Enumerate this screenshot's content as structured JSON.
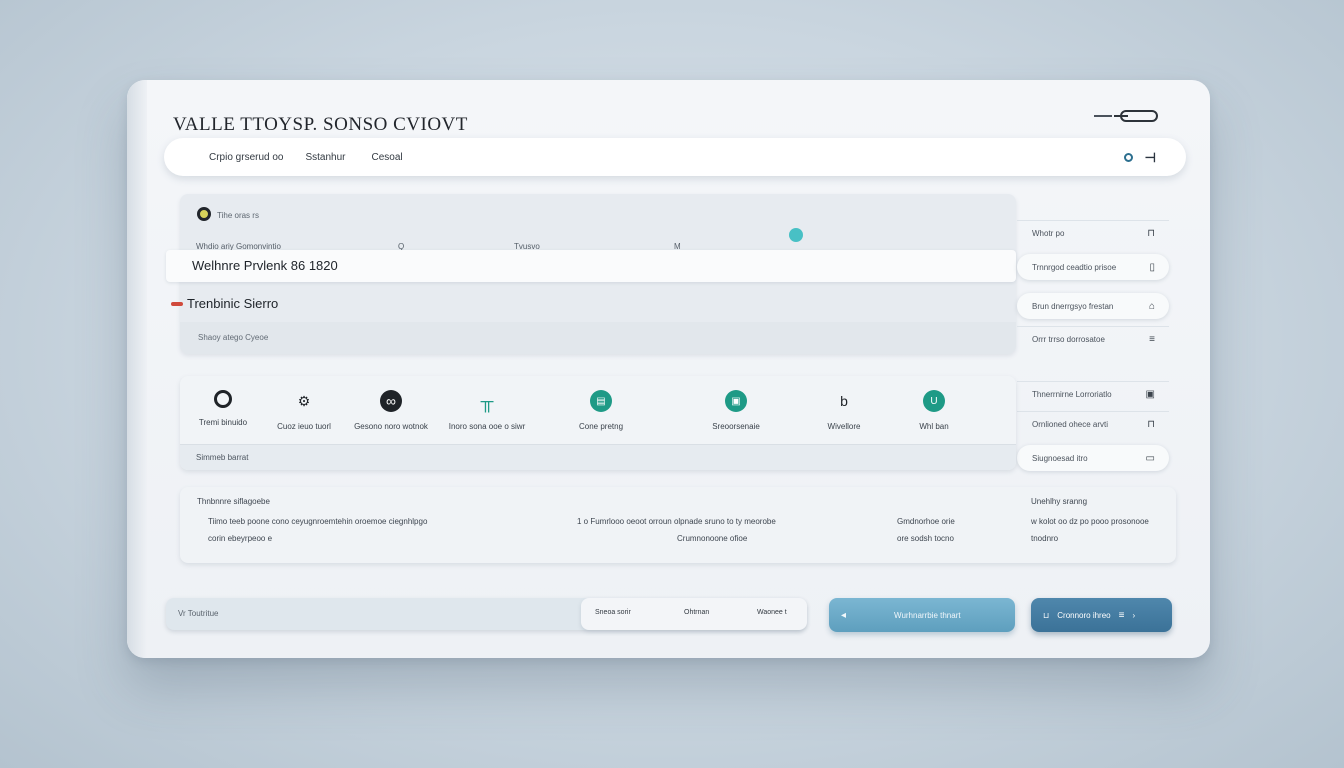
{
  "app": {
    "title": "VALLE TTOYSP. SONSO CVIOVT"
  },
  "top_bar": {
    "tabs": [
      "Crpio grserud oo",
      "Sstanhur",
      "Cesoal"
    ]
  },
  "panel_a": {
    "subtitle": "Tihe oras rs",
    "columns": [
      "Whdio ariy Gomonvintio",
      "Q",
      "Tvusvo",
      "M"
    ],
    "record_title": "Welhnre Prvlenk 86 1820",
    "section_name": "Trenbinic Sierro",
    "sub_caption": "Shaoy atego Cyeoe"
  },
  "right_list": [
    {
      "label": "Whotr po",
      "icon": "⊓"
    },
    {
      "label": "Trnnrgod ceadtio prisoe",
      "icon": "▯"
    },
    {
      "label": "Brun dnerrgsyo frestan",
      "icon": "⌂"
    },
    {
      "label": "Orrr trrso dorrosatoe",
      "icon": "≡"
    },
    {
      "label": "Thnerrnirne Lorroriatlo",
      "icon": "▣"
    },
    {
      "label": "Ornlioned ohece arvti",
      "icon": "⊓"
    },
    {
      "label": "Siugnoesad itro",
      "icon": "▭"
    }
  ],
  "tools": [
    {
      "label": "Tremi binuido",
      "icon": "gear-icon",
      "glyph": "⚙"
    },
    {
      "label": "Cuoz ieuo tuorl",
      "icon": "settings-icon",
      "glyph": "⚙"
    },
    {
      "label": "Gesono noro wotnok",
      "icon": "link-icon",
      "glyph": "∞"
    },
    {
      "label": "Inoro sona ooe o siwr",
      "icon": "table-icon",
      "glyph": "╥"
    },
    {
      "label": "Cone pretng",
      "icon": "document-icon",
      "glyph": "▤"
    },
    {
      "label": "Sreoorsenaie",
      "icon": "clipboard-icon",
      "glyph": "▣"
    },
    {
      "label": "Wivellore",
      "icon": "hook-icon",
      "glyph": "b"
    },
    {
      "label": "Whl ban",
      "icon": "cup-icon",
      "glyph": "U"
    }
  ],
  "toolbar_footer": "Simmeb barrat",
  "info_panel": {
    "heading": "Thnbnnre siflagoebe",
    "line_1": "Tiimo teeb poone cono ceyugnroemtehin oroemoe ciegnhlpgo",
    "line_2": "corin ebeyrpeoo e",
    "mid_1": "1 o  Fumrlooo oeoot orroun olpnade sruno to ty meorobe",
    "mid_2": "Crumnonoone ofioe",
    "side_1": "Gmdnorhoe orie",
    "side_2": "ore sodsh tocno",
    "right_heading": "Unehlhy sranng",
    "right_1": "w kolot oo dz po pooo prosonooe",
    "right_2": "tnodnro"
  },
  "bottom_bar": {
    "hint": "Vr  Toutritue",
    "segments": [
      "Sneoa sorir",
      "Ohtrnan",
      "Waonee t"
    ]
  },
  "buttons": {
    "secondary": "Wurhnarrbie thnart",
    "primary": "Cronnoro ihreo"
  }
}
